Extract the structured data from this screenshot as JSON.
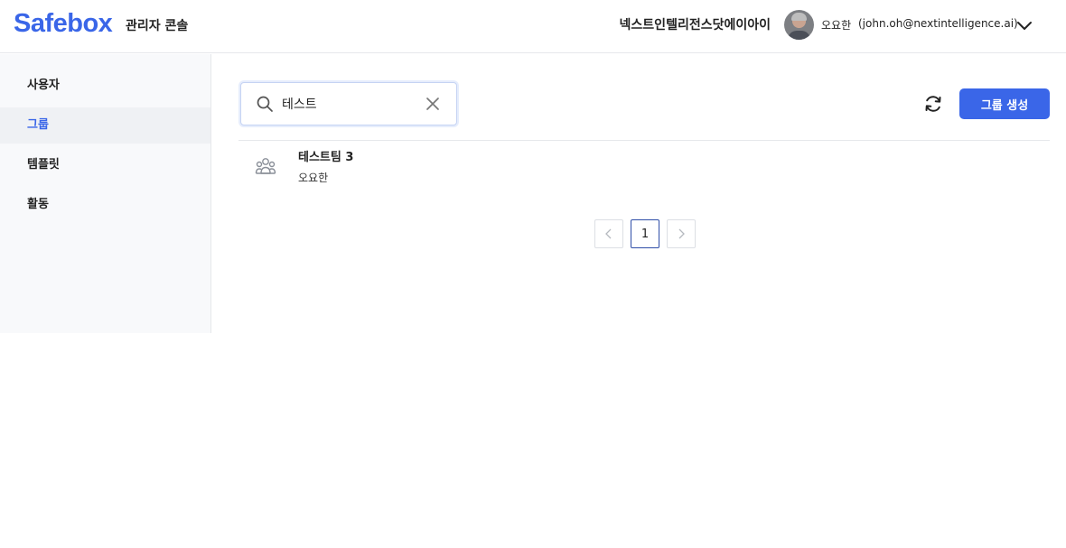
{
  "header": {
    "brand": "Safebox",
    "console_label": "관리자 콘솔",
    "org_name": "넥스트인텔리전스닷에이아이",
    "user": {
      "name": "오요한",
      "email": "(john.oh@nextintelligence.ai)"
    },
    "icons": {
      "avatar": "user-avatar",
      "menu": "chevron-down-icon"
    }
  },
  "sidebar": {
    "items": [
      {
        "label": "사용자",
        "active": false
      },
      {
        "label": "그룹",
        "active": true
      },
      {
        "label": "템플릿",
        "active": false
      },
      {
        "label": "활동",
        "active": false
      }
    ]
  },
  "main": {
    "search": {
      "value": "테스트",
      "placeholder": ""
    },
    "create_button_label": "그룹 생성",
    "groups": [
      {
        "name": "테스트팀 3",
        "owner": "오요한",
        "icon": "group-icon"
      }
    ],
    "pagination": {
      "current_page": "1"
    }
  },
  "colors": {
    "accent": "#3a66e8",
    "sidebar_bg": "#f8f9fb",
    "active_item_bg": "#eff1f4",
    "border": "#e6e8eb"
  }
}
